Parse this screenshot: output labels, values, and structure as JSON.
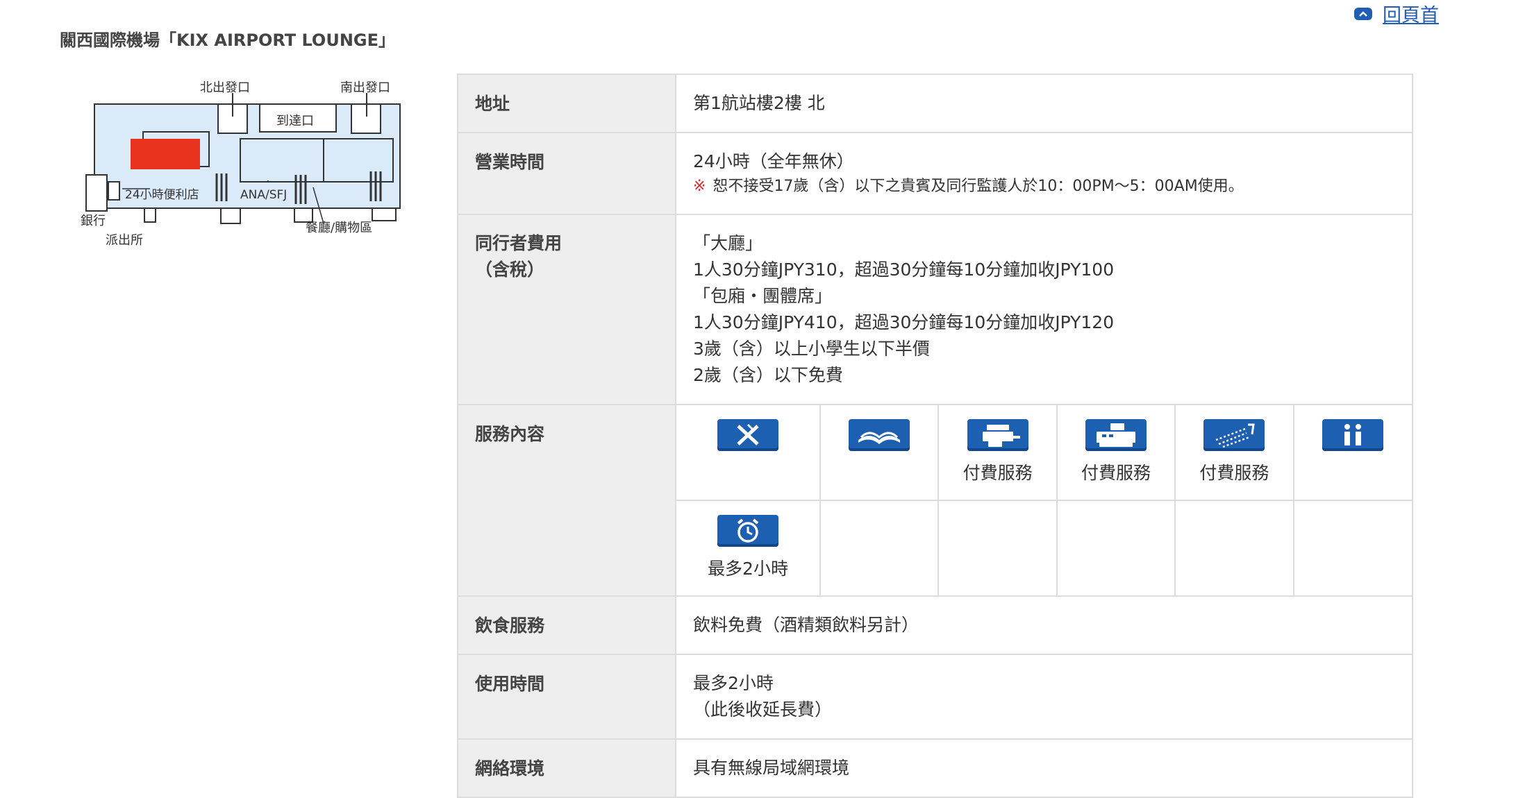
{
  "nav": {
    "back_to_top": "回頁首"
  },
  "title": "關西國際機場「KIX AIRPORT LOUNGE」",
  "map": {
    "labels": {
      "north_exit": "北出發口",
      "south_exit": "南出發口",
      "arrival": "到達口",
      "convenience": "24小時便利店",
      "ana": "ANA/SFJ",
      "bank": "銀行",
      "police": "派出所",
      "dining": "餐廳/購物區"
    },
    "colors": {
      "lounge": "#e8321e",
      "floor": "#dbeaf8",
      "walls": "#333333"
    }
  },
  "rows": {
    "address": {
      "label": "地址",
      "value": "第1航站樓2樓 北"
    },
    "hours": {
      "label": "營業時間",
      "value": "24小時（全年無休）",
      "note_mark": "※",
      "note": "恕不接受17歲（含）以下之貴賓及同行監護人於10：00PM～5：00AM使用。"
    },
    "fee": {
      "label_line1": "同行者費用",
      "label_line2": "（含稅）",
      "lines": [
        "「大廳」",
        "1人30分鐘JPY310，超過30分鐘每10分鐘加收JPY100",
        "「包廂・團體席」",
        "1人30分鐘JPY410，超過30分鐘每10分鐘加收JPY120",
        "3歲（含）以上小學生以下半價",
        "2歲（含）以下免費"
      ]
    },
    "services": {
      "label": "服務內容",
      "items": [
        {
          "icon": "no-smoking-icon",
          "caption": ""
        },
        {
          "icon": "magazine-icon",
          "caption": ""
        },
        {
          "icon": "copy-machine-icon",
          "caption": "付費服務"
        },
        {
          "icon": "fax-icon",
          "caption": "付費服務"
        },
        {
          "icon": "shower-icon",
          "caption": "付費服務"
        },
        {
          "icon": "information-icon",
          "caption": ""
        },
        {
          "icon": "alarm-clock-icon",
          "caption": "最多2小時"
        }
      ]
    },
    "food": {
      "label": "飲食服務",
      "value": "飲料免費（酒精類飲料另計）"
    },
    "usage": {
      "label": "使用時間",
      "value_line1": "最多2小時",
      "value_line2": "（此後收延長費）"
    },
    "network": {
      "label": "網絡環境",
      "value": "具有無線局域網環境"
    }
  }
}
